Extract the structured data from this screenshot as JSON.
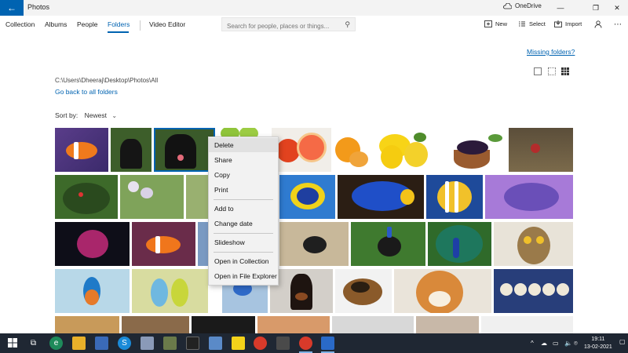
{
  "titlebar": {
    "app_title": "Photos",
    "back_glyph": "←",
    "onedrive_label": "OneDrive",
    "minimize_glyph": "—",
    "restore_glyph": "❐",
    "close_glyph": "✕"
  },
  "nav": {
    "tabs": [
      {
        "label": "Collection"
      },
      {
        "label": "Albums"
      },
      {
        "label": "People"
      },
      {
        "label": "Folders"
      },
      {
        "label": "Video Editor"
      }
    ],
    "active_tab": "Folders"
  },
  "search": {
    "placeholder": "Search for people, places or things..."
  },
  "toolbar": {
    "new_label": "New",
    "select_label": "Select",
    "import_label": "Import"
  },
  "folder": {
    "missing_link": "Missing folders?",
    "path": "C:\\Users\\Dheeraj\\Desktop\\Photos\\All",
    "go_back": "Go back to all folders",
    "sort_label": "Sort by:",
    "sort_value": "Newest"
  },
  "context_menu": {
    "items": [
      {
        "label": "Delete"
      },
      {
        "label": "Share"
      },
      {
        "label": "Copy"
      },
      {
        "label": "Print"
      },
      {
        "label": "Add to"
      },
      {
        "label": "Change date"
      },
      {
        "label": "Slideshow"
      },
      {
        "label": "Open in Collection"
      },
      {
        "label": "Open in File Explorer"
      }
    ]
  },
  "taskbar": {
    "time": "19:11",
    "date": "13-02-2021"
  },
  "colors": {
    "accent": "#0063b1",
    "taskbar": "#1f2733"
  }
}
